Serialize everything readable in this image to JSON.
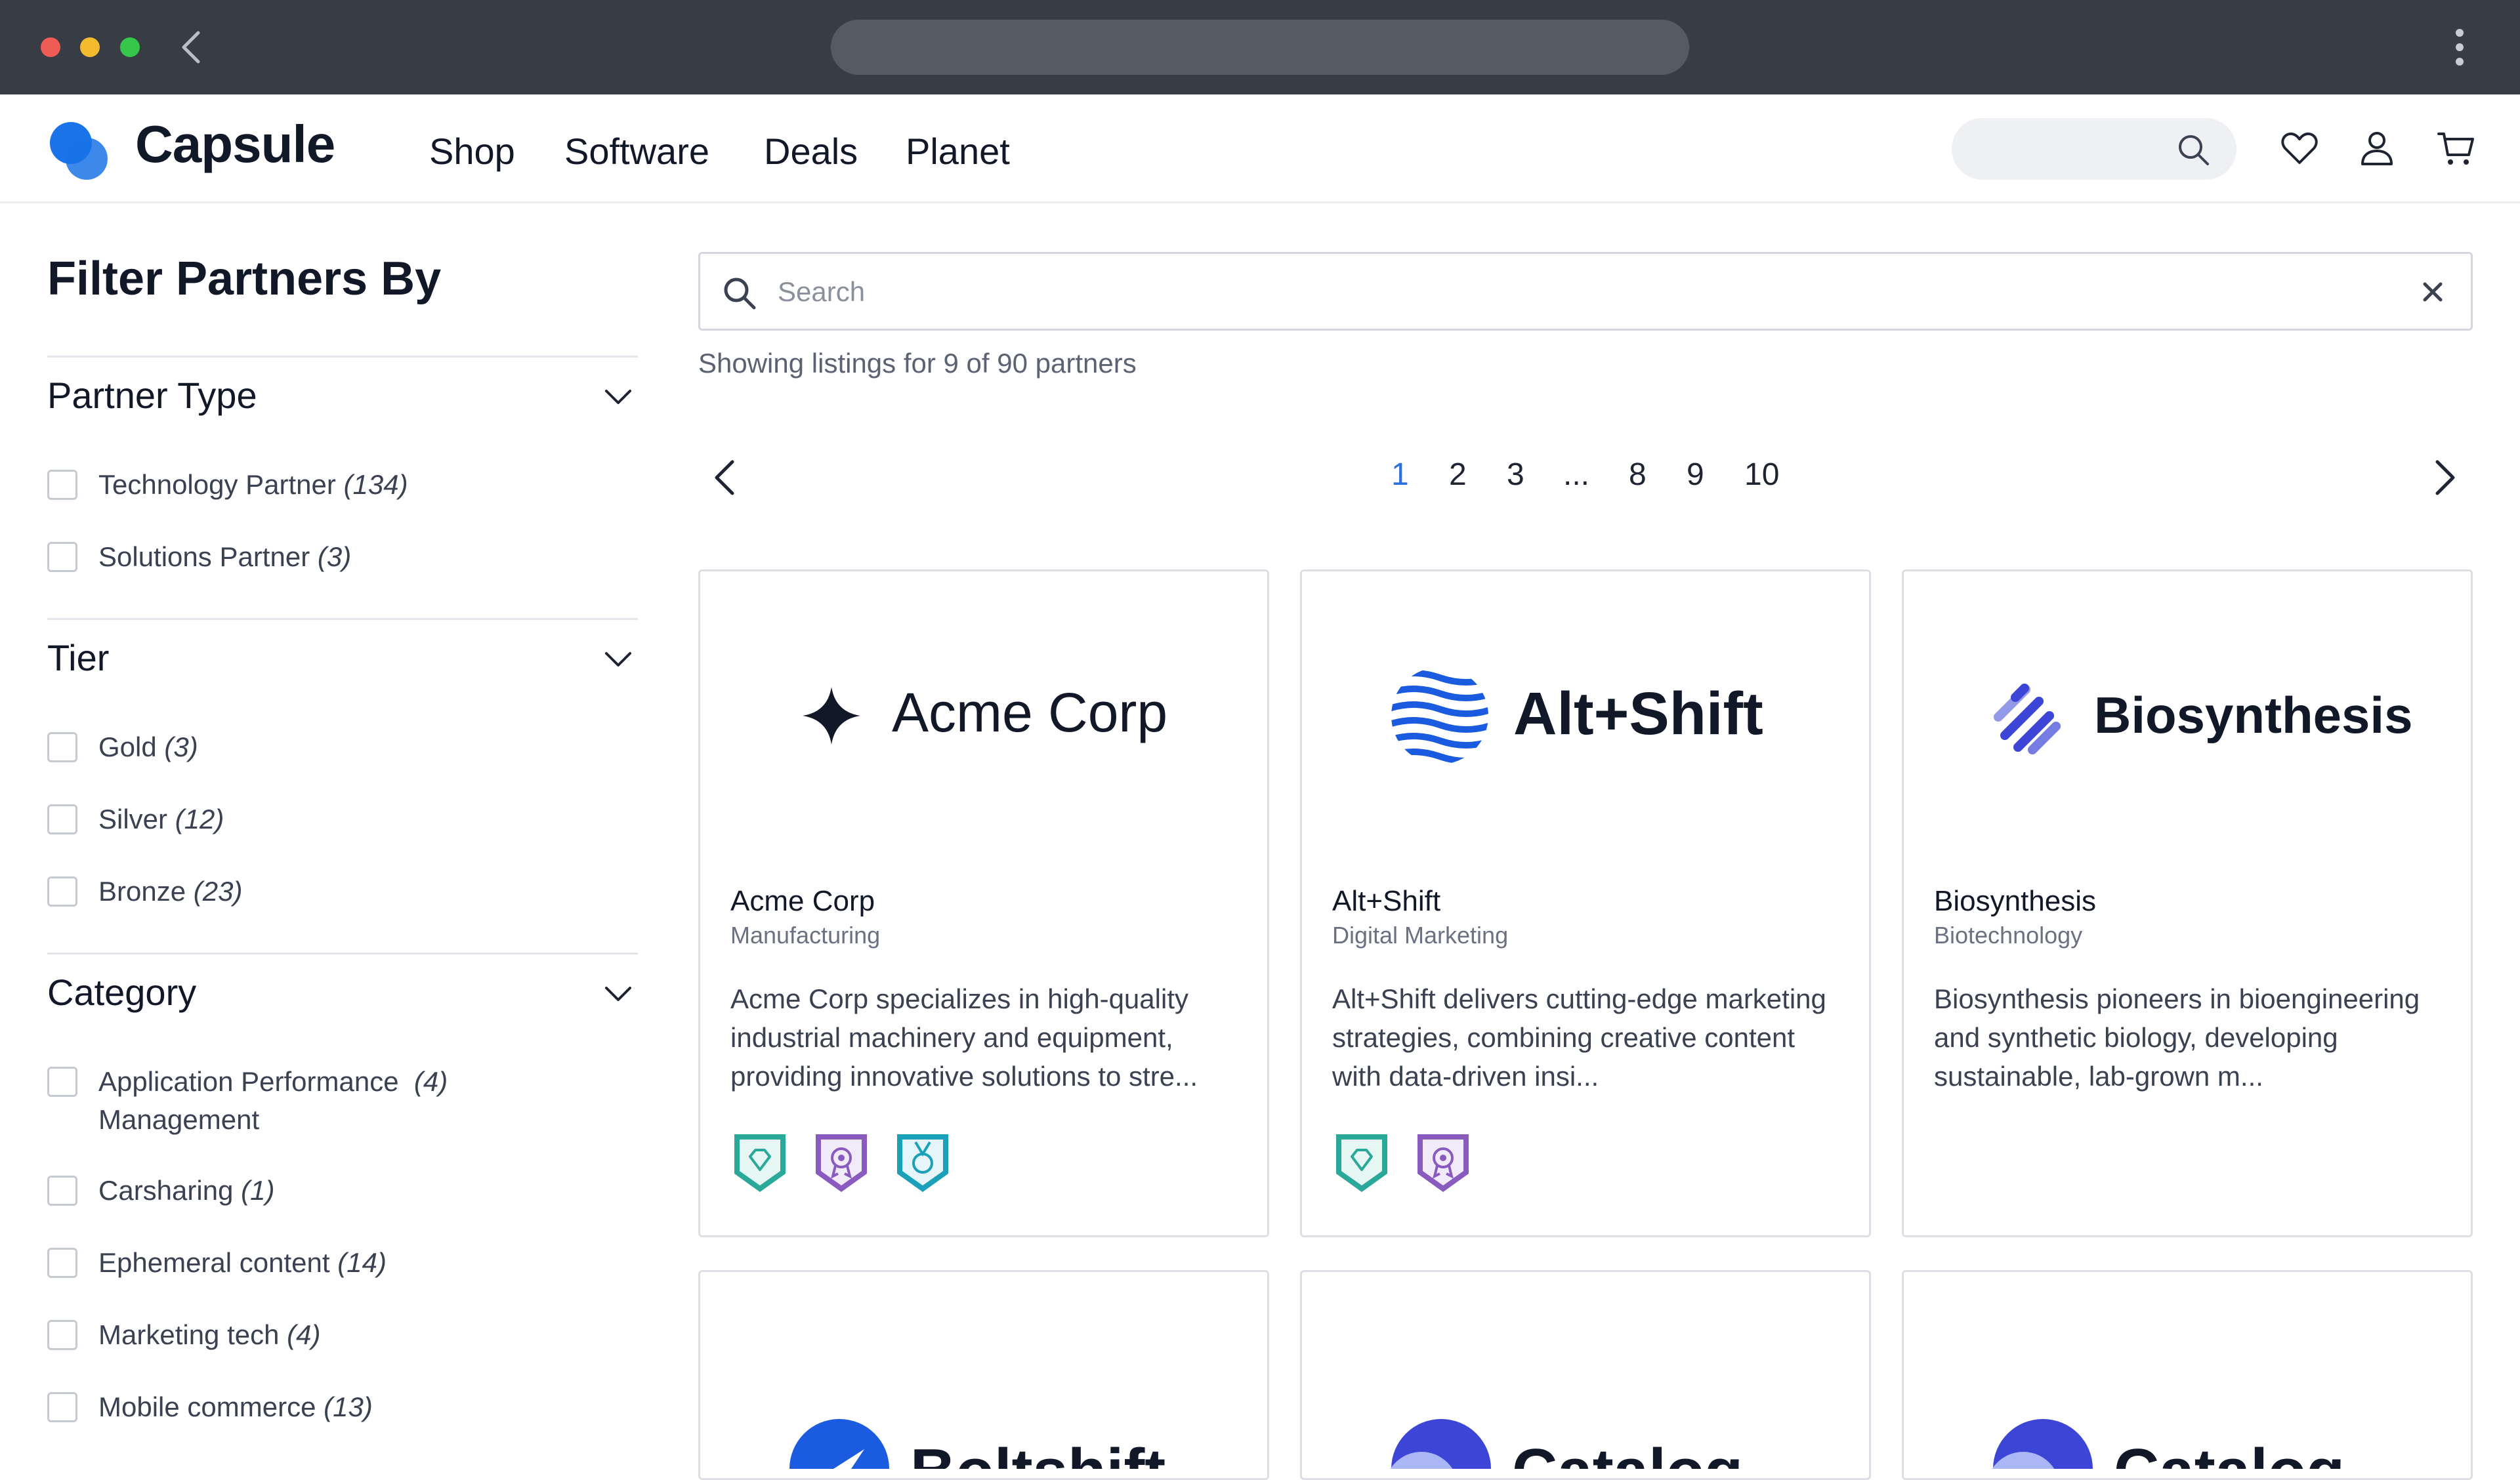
{
  "browser": {
    "url": ""
  },
  "brand": {
    "name": "Capsule"
  },
  "nav": {
    "links": [
      "Shop",
      "Software",
      "Deals",
      "Planet"
    ],
    "search_placeholder": ""
  },
  "sidebar": {
    "title": "Filter Partners By",
    "sections": [
      {
        "title": "Partner Type",
        "options": [
          {
            "label": "Technology Partner",
            "count": "(134)"
          },
          {
            "label": "Solutions Partner",
            "count": "(3)"
          }
        ]
      },
      {
        "title": "Tier",
        "options": [
          {
            "label": "Gold",
            "count": "(3)"
          },
          {
            "label": "Silver",
            "count": "(12)"
          },
          {
            "label": "Bronze",
            "count": "(23)"
          }
        ]
      },
      {
        "title": "Category",
        "options": [
          {
            "label": "Application Performance",
            "label2": "Management",
            "count": "(4)"
          },
          {
            "label": "Carsharing",
            "count": "(1)"
          },
          {
            "label": "Ephemeral content",
            "count": "(14)"
          },
          {
            "label": "Marketing tech",
            "count": "(4)"
          },
          {
            "label": "Mobile commerce",
            "count": "(13)"
          }
        ]
      }
    ]
  },
  "search": {
    "placeholder": "Search",
    "value": ""
  },
  "results": {
    "showing": "Showing listings for 9 of 90 partners"
  },
  "pagination": {
    "pages": [
      "1",
      "2",
      "3",
      "...",
      "8",
      "9",
      "10"
    ],
    "current": "1"
  },
  "colors": {
    "accent": "#2c6fe0",
    "brand_blue": "#1a73e8",
    "badge_teal": "#2aa89a",
    "badge_purple": "#8a5bbf"
  },
  "cards": [
    {
      "logo_text": "Acme Corp",
      "name": "Acme Corp",
      "category": "Manufacturing",
      "description": "Acme Corp specializes in high-quality industrial machinery and equipment, providing innovative solutions to stre...",
      "badges": [
        "diamond-badge-icon",
        "award-badge-icon",
        "medal-badge-icon"
      ]
    },
    {
      "logo_text": "Alt+Shift",
      "name": "Alt+Shift",
      "category": "Digital Marketing",
      "description": "Alt+Shift delivers cutting-edge marketing strategies, combining creative content with data-driven insi...",
      "badges": [
        "diamond-badge-icon",
        "award-badge-icon"
      ]
    },
    {
      "logo_text": "Biosynthesis",
      "name": "Biosynthesis",
      "category": "Biotechnology",
      "description": "Biosynthesis pioneers in bioengineering and synthetic biology, developing sustainable, lab-grown m...",
      "badges": []
    },
    {
      "logo_text": "Boltshift"
    },
    {
      "logo_text": "Catalog"
    },
    {
      "logo_text": "Catalog"
    }
  ]
}
